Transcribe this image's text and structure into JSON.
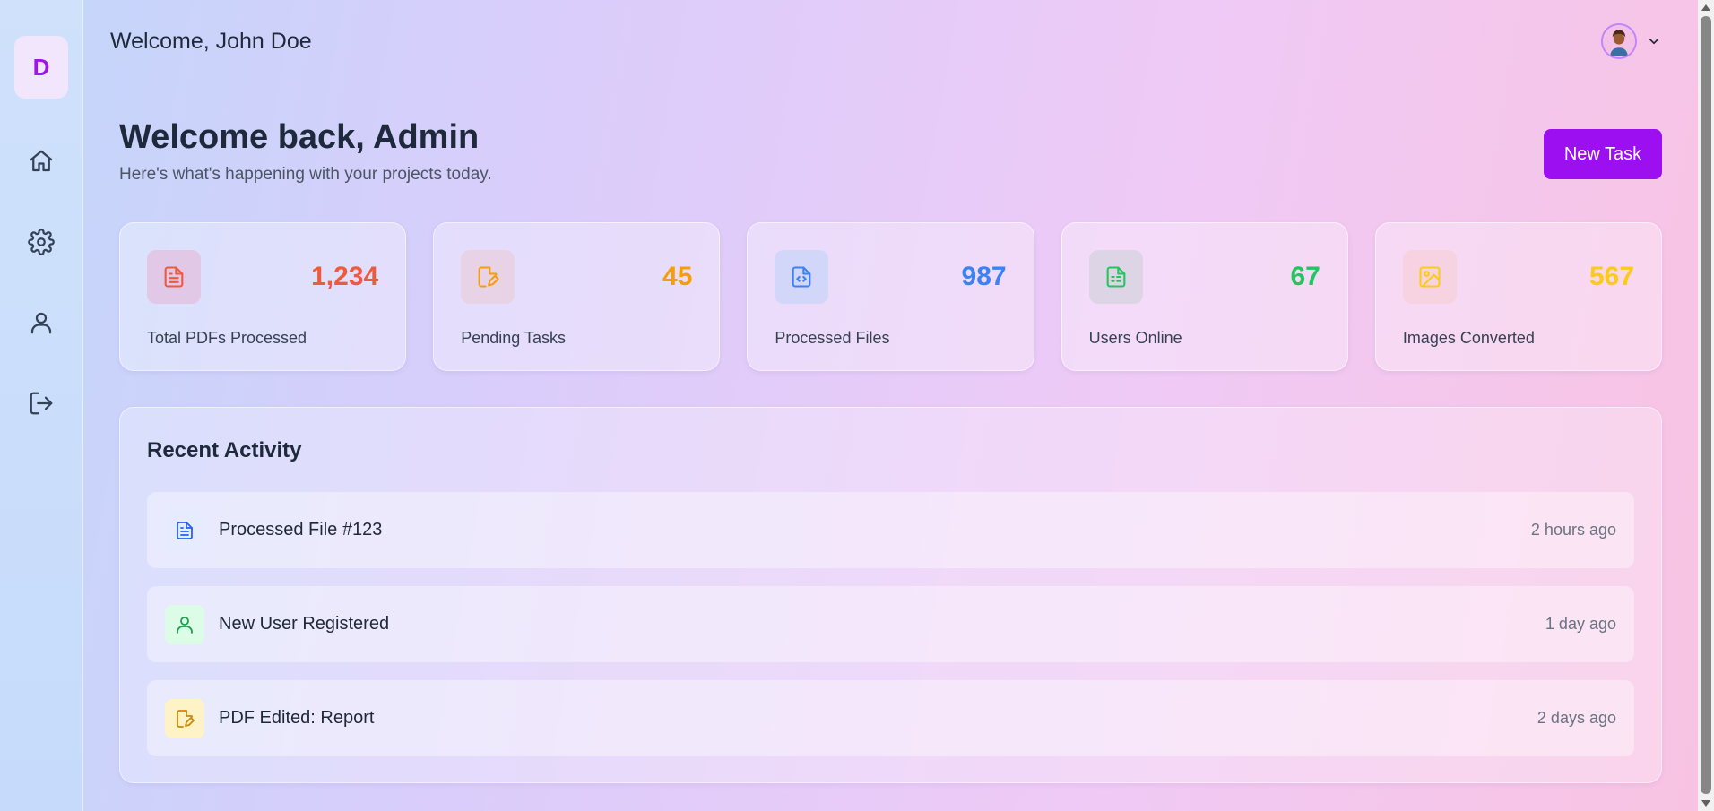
{
  "app": {
    "logo_letter": "D"
  },
  "colors": {
    "accent": "#9b0ff0",
    "pdf": "#ef5a3c",
    "pending": "#f59e0b",
    "files": "#3b82f6",
    "users": "#22c55e",
    "images": "#facc15"
  },
  "sidebar": {
    "items": [
      {
        "icon": "home-icon"
      },
      {
        "icon": "gear-icon"
      },
      {
        "icon": "user-icon"
      },
      {
        "icon": "logout-icon"
      }
    ]
  },
  "header": {
    "greeting": "Welcome, John Doe",
    "avatar_icon": "avatar",
    "menu_icon": "chevron-down-icon"
  },
  "hero": {
    "title": "Welcome back, Admin",
    "subtitle": "Here's what's happening with your projects today.",
    "new_task_label": "New Task"
  },
  "stats": [
    {
      "value": "1,234",
      "label": "Total PDFs Processed",
      "icon": "pdf-file-icon"
    },
    {
      "value": "45",
      "label": "Pending Tasks",
      "icon": "file-edit-icon"
    },
    {
      "value": "987",
      "label": "Processed Files",
      "icon": "code-file-icon"
    },
    {
      "value": "67",
      "label": "Users Online",
      "icon": "spreadsheet-file-icon"
    },
    {
      "value": "567",
      "label": "Images Converted",
      "icon": "image-icon"
    }
  ],
  "activity": {
    "title": "Recent Activity",
    "items": [
      {
        "title": "Processed File #123",
        "time": "2 hours ago",
        "icon": "document-icon"
      },
      {
        "title": "New User Registered",
        "time": "1 day ago",
        "icon": "user-icon"
      },
      {
        "title": "PDF Edited: Report",
        "time": "2 days ago",
        "icon": "file-edit-icon"
      }
    ]
  }
}
